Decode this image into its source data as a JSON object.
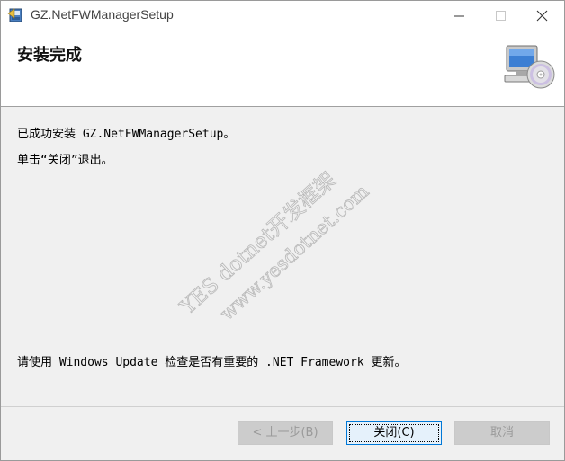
{
  "window": {
    "title": "GZ.NetFWManagerSetup"
  },
  "header": {
    "title": "安装完成",
    "icon": "computer-cd-icon"
  },
  "content": {
    "line1": "已成功安装 GZ.NetFWManagerSetup。",
    "line2": "单击“关闭”退出。",
    "line3": "请使用 Windows Update 检查是否有重要的 .NET Framework 更新。"
  },
  "watermark": {
    "line1": "YES dotnet开发框架",
    "line2": "www.yesdotnet.com"
  },
  "buttons": {
    "back": "< 上一步(B)",
    "close": "关闭(C)",
    "cancel": "取消"
  }
}
